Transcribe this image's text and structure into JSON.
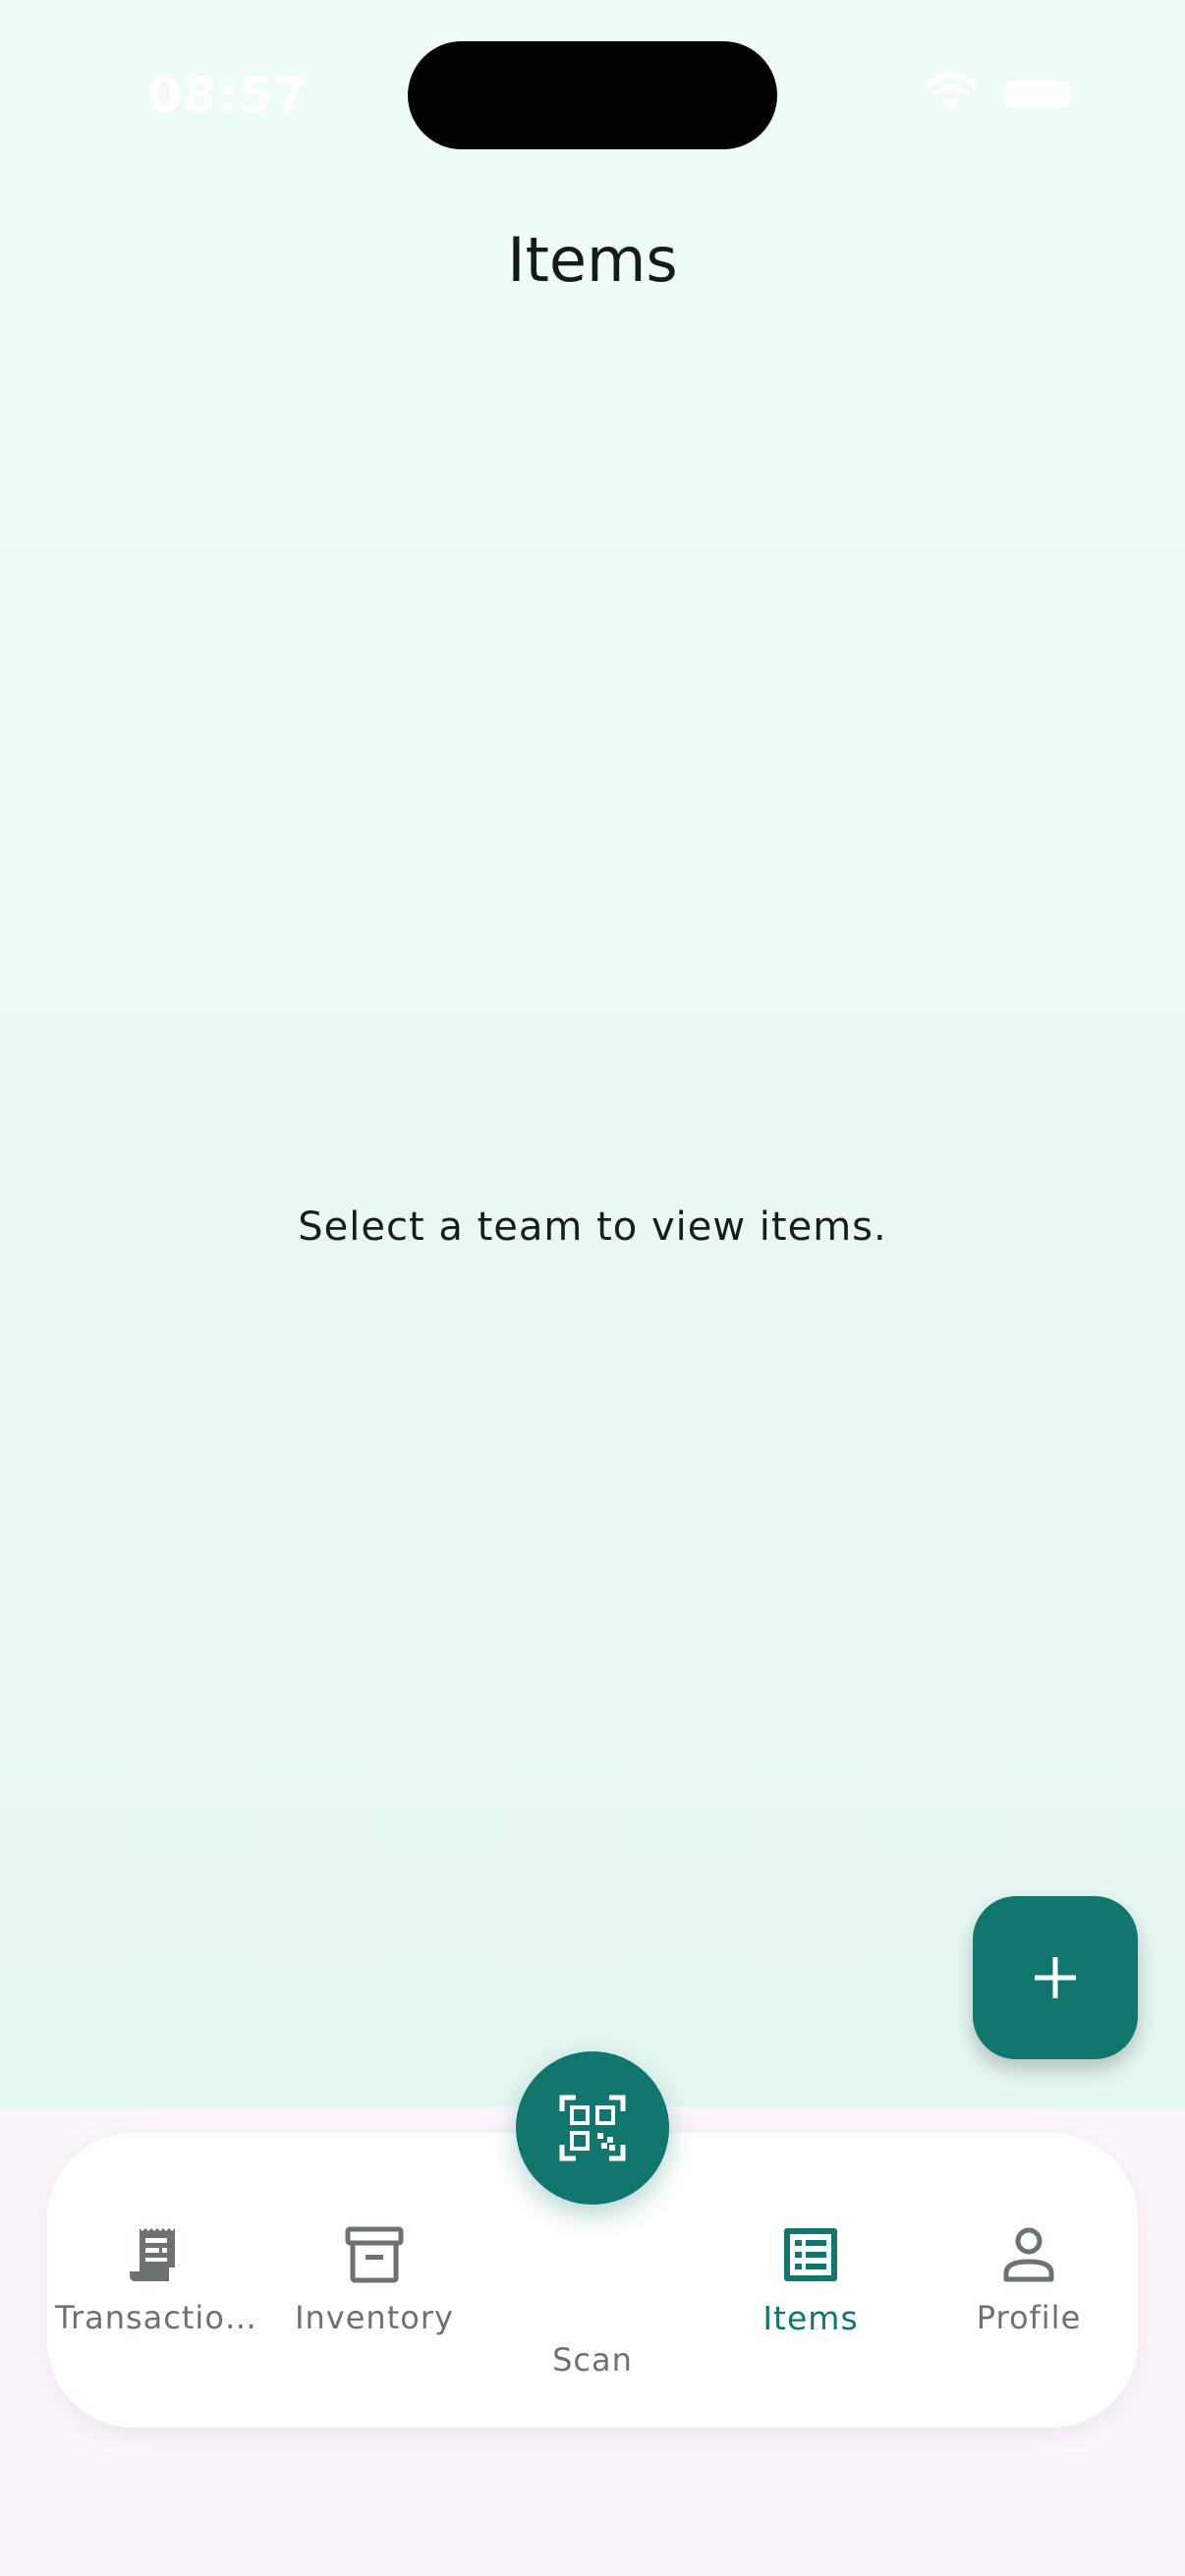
{
  "status_bar": {
    "time": "08:57"
  },
  "header": {
    "title": "Items"
  },
  "main": {
    "empty_message": "Select a team to view items."
  },
  "fab": {
    "icon": "plus-icon"
  },
  "nav": {
    "items": [
      {
        "label": "Transactio…",
        "icon": "receipt-icon"
      },
      {
        "label": "Inventory",
        "icon": "archive-box-icon"
      },
      {
        "label": "Scan",
        "icon": "qr-code-scan-icon"
      },
      {
        "label": "Items",
        "icon": "list-alt-icon",
        "active": true
      },
      {
        "label": "Profile",
        "icon": "person-icon"
      }
    ]
  },
  "colors": {
    "accent": "#11766d",
    "inactive": "#6b7372",
    "background_top": "#effcf7",
    "nav_background": "#ffffff"
  }
}
